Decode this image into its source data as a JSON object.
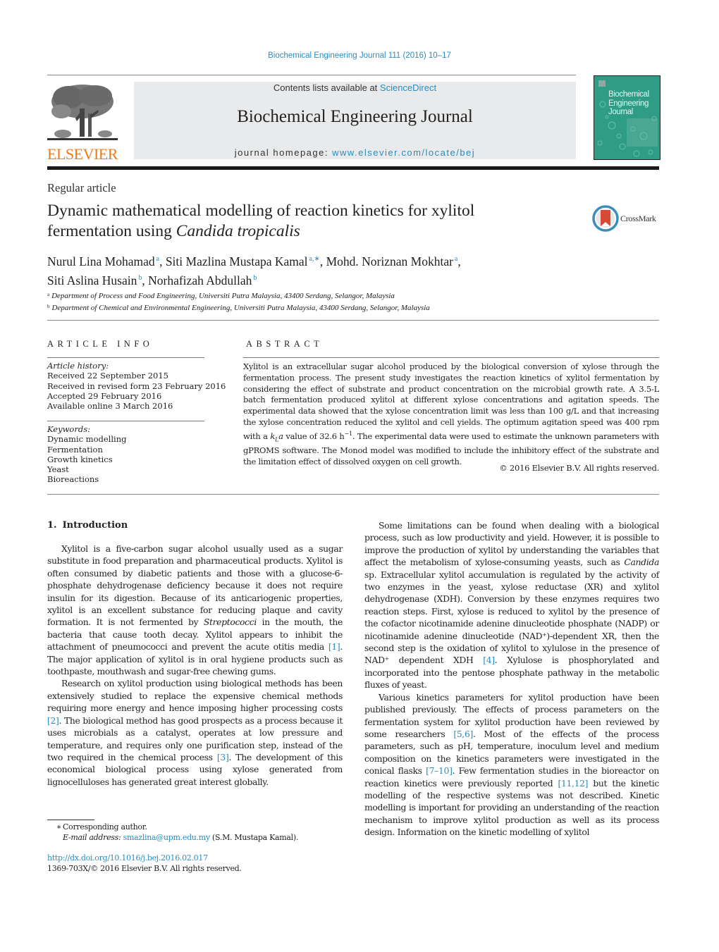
{
  "running_head": "Biochemical Engineering Journal 111 (2016) 10–17",
  "masthead": {
    "publisher": "ELSEVIER",
    "contents_prefix": "Contents lists available at ",
    "contents_link": "ScienceDirect",
    "journal_title": "Biochemical Engineering Journal",
    "homepage_prefix": "journal homepage: ",
    "homepage_link": "www.elsevier.com/locate/bej",
    "cover_title_lines": [
      "Biochemical",
      "Engineering",
      "Journal"
    ]
  },
  "article": {
    "type": "Regular article",
    "title_line1": "Dynamic mathematical modelling of reaction kinetics for xylitol",
    "title_line2_plain": "fermentation using ",
    "title_line2_italic": "Candida tropicalis",
    "crossmark_label": "CrossMark",
    "authors": [
      {
        "name": "Nurul Lina Mohamad",
        "sup": "a",
        "sep": ", "
      },
      {
        "name": "Siti Mazlina Mustapa Kamal",
        "sup": "a,∗",
        "sep": ", "
      },
      {
        "name": "Mohd. Noriznan Mokhtar",
        "sup": "a",
        "sep": ","
      },
      {
        "name": "Siti Aslina Husain",
        "sup": "b",
        "sep": ", "
      },
      {
        "name": "Norhafizah Abdullah",
        "sup": "b",
        "sep": ""
      }
    ],
    "affiliations": [
      {
        "key": "a",
        "text": "Department of Process and Food Engineering, Universiti Putra Malaysia, 43400 Serdang, Selangor, Malaysia"
      },
      {
        "key": "b",
        "text": "Department of Chemical and Environmental Engineering, Universiti Putra Malaysia, 43400 Serdang, Selangor, Malaysia"
      }
    ]
  },
  "article_info": {
    "heading": "ARTICLE INFO",
    "history_label": "Article history:",
    "history": [
      "Received 22 September 2015",
      "Received in revised form 23 February 2016",
      "Accepted 29 February 2016",
      "Available online 3 March 2016"
    ],
    "keywords_label": "Keywords:",
    "keywords": [
      "Dynamic modelling",
      "Fermentation",
      "Growth kinetics",
      "Yeast",
      "Bioreactions"
    ]
  },
  "abstract": {
    "heading": "ABSTRACT",
    "text_before_kla": "Xylitol is an extracellular sugar alcohol produced by the biological conversion of xylose through the fermentation process. The present study investigates the reaction kinetics of xylitol fermentation by considering the effect of substrate and product concentration on the microbial growth rate. A 3.5-L batch fermentation produced xylitol at different xylose concentrations and agitation speeds. The experimental data showed that the xylose concentration limit was less than 100 g/L and that increasing the xylose concentration reduced the xylitol and cell yields. The optimum agitation speed was 400 rpm with a ",
    "kla_symbol": "kLa",
    "text_after_kla": " value of 32.6 h",
    "unit_exponent": "−1",
    "text_end": ". The experimental data were used to estimate the unknown parameters with gPROMS software. The Monod model was modified to include the inhibitory effect of the substrate and the limitation effect of dissolved oxygen on cell growth.",
    "copyright": "© 2016 Elsevier B.V. All rights reserved."
  },
  "body": {
    "section_number": "1.",
    "section_title": "Introduction",
    "left_paragraphs": [
      {
        "segments": [
          {
            "t": "Xylitol is a five-carbon sugar alcohol usually used as a sugar substitute in food preparation and pharmaceutical products. Xylitol is often consumed by diabetic patients and those with a glucose-6-phosphate dehydrogenase deficiency because it does not require insulin for its digestion. Because of its anticariogenic properties, xylitol is an excellent substance for reducing plaque and cavity formation. It is not fermented by "
          },
          {
            "t": "Streptococci",
            "style": "italic"
          },
          {
            "t": " in the mouth, the bacteria that cause tooth decay. Xylitol appears to inhibit the attachment of pneumococci and prevent the acute otitis media "
          },
          {
            "t": "[1]",
            "style": "ref"
          },
          {
            "t": ". The major application of xylitol is in oral hygiene products such as toothpaste, mouthwash and sugar-free chewing gums."
          }
        ]
      },
      {
        "segments": [
          {
            "t": "Research on xylitol production using biological methods has been extensively studied to replace the expensive chemical methods requiring more energy and hence imposing higher processing costs "
          },
          {
            "t": "[2]",
            "style": "ref"
          },
          {
            "t": ". The biological method has good prospects as a process because it uses microbials as a catalyst, operates at low pressure and temperature, and requires only one purification step, instead of the two required in the chemical process "
          },
          {
            "t": "[3]",
            "style": "ref"
          },
          {
            "t": ". The development of this economical biological process using xylose generated from lignocelluloses has generated great interest globally."
          }
        ]
      }
    ],
    "right_paragraphs": [
      {
        "segments": [
          {
            "t": "Some limitations can be found when dealing with a biological process, such as low productivity and yield. However, it is possible to improve the production of xylitol by understanding the variables that affect the metabolism of xylose-consuming yeasts, such as "
          },
          {
            "t": "Candida",
            "style": "italic"
          },
          {
            "t": " sp. Extracellular xylitol accumulation is regulated by the activity of two enzymes in the yeast, xylose reductase (XR) and xylitol dehydrogenase (XDH). Conversion by these enzymes requires two reaction steps. First, xylose is reduced to xylitol by the presence of the cofactor nicotinamide adenine dinucleotide phosphate (NADP) or nicotinamide adenine dinucleotide (NAD⁺)-dependent XR, then the second step is the oxidation of xylitol to xylulose in the presence of NAD⁺ dependent XDH "
          },
          {
            "t": "[4]",
            "style": "ref"
          },
          {
            "t": ". Xylulose is phosphorylated and incorporated into the pentose phosphate pathway in the metabolic fluxes of yeast."
          }
        ]
      },
      {
        "segments": [
          {
            "t": "Various kinetics parameters for xylitol production have been published previously. The effects of process parameters on the fermentation system for xylitol production have been reviewed by some researchers "
          },
          {
            "t": "[5,6]",
            "style": "ref"
          },
          {
            "t": ". Most of the effects of the process parameters, such as pH, temperature, inoculum level and medium composition on the kinetics parameters were investigated in the conical flasks "
          },
          {
            "t": "[7–10]",
            "style": "ref"
          },
          {
            "t": ". Few fermentation studies in the bioreactor on reaction kinetics were previously reported "
          },
          {
            "t": "[11,12]",
            "style": "ref"
          },
          {
            "t": " but the kinetic modelling of the respective systems was not described. Kinetic modelling is important for providing an understanding of the reaction mechanism to improve xylitol production as well as its process design. Information on the kinetic modelling of xylitol"
          }
        ]
      }
    ]
  },
  "footnote": {
    "star": "∗",
    "corresponding": "Corresponding author.",
    "email_label": "E-mail address:",
    "email": "smazlina@upm.edu.my",
    "email_suffix": " (S.M. Mustapa Kamal).",
    "doi": "http://dx.doi.org/10.1016/j.bej.2016.02.017",
    "issn_line": "1369-703X/© 2016 Elsevier B.V. All rights reserved."
  },
  "colors": {
    "link": "#2a8cbf",
    "elsevier_orange": "#f07a1a",
    "cover_teal": "#2f9c86",
    "masthead_gray": "#e9eaeb",
    "crossmark_red": "#d84a36",
    "crossmark_blue": "#3c8dbd"
  }
}
